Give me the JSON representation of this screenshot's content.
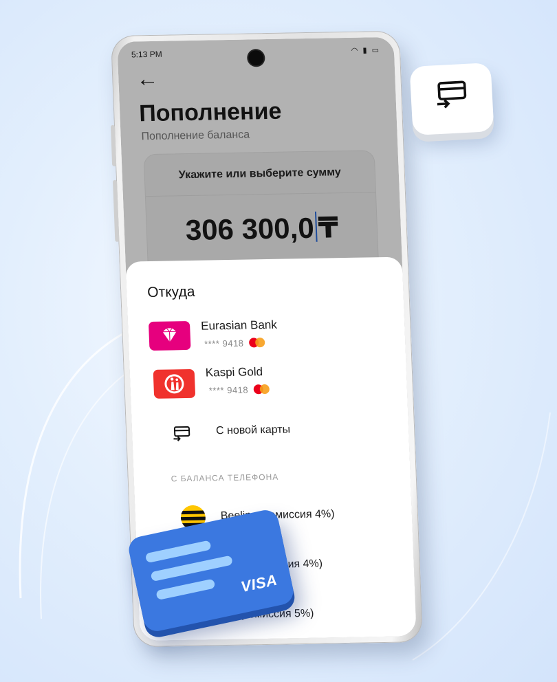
{
  "status_bar": {
    "time": "5:13 PM"
  },
  "header": {
    "back_icon": "arrow-left-icon",
    "title": "Пополнение",
    "subtitle": "Пополнение баланса"
  },
  "amount": {
    "label": "Укажите или выберите сумму",
    "value": "306 300,0",
    "currency": "₸"
  },
  "sheet": {
    "title": "Откуда",
    "cards": [
      {
        "name": "Eurasian Bank",
        "mask": "**** 9418",
        "logo_color": "#e6007e",
        "icon": "diamond-icon",
        "network": "mastercard-icon"
      },
      {
        "name": "Kaspi Gold",
        "mask": "**** 9418",
        "logo_color": "#f0322d",
        "icon": "kaspi-logo-icon",
        "network": "mastercard-icon"
      }
    ],
    "new_card": {
      "label": "С новой карты",
      "icon": "card-transfer-icon"
    },
    "phone_section_title": "С БАЛАНСА ТЕЛЕФОНА",
    "operators": [
      {
        "name": "Beeline (комиссия 4%)",
        "icon": "beeline-icon"
      },
      {
        "name": "Altel (комиссия 4%)"
      },
      {
        "name": "Kcell/Activ (комиссия 5%)"
      }
    ]
  },
  "badge": {
    "icon": "card-transfer-icon"
  },
  "visa_card": {
    "brand": "VISA",
    "color": "#3b78e0",
    "stripe_color": "#9fd0ff"
  }
}
